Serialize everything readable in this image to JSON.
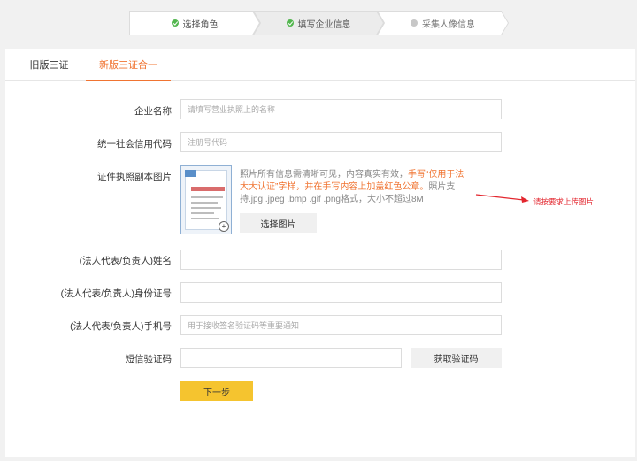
{
  "stepper": {
    "steps": [
      {
        "label": "选择角色",
        "status": "done"
      },
      {
        "label": "填写企业信息",
        "status": "done"
      },
      {
        "label": "采集人像信息",
        "status": "todo"
      }
    ]
  },
  "tabs": [
    {
      "label": "旧版三证",
      "active": false
    },
    {
      "label": "新版三证合一",
      "active": true
    }
  ],
  "form": {
    "company_name": {
      "label": "企业名称",
      "value": "",
      "placeholder": "请填写营业执照上的名称"
    },
    "credit_code": {
      "label": "统一社会信用代码",
      "value": "",
      "placeholder": "注册号代码"
    },
    "license": {
      "label": "证件执照副本图片",
      "desc_prefix": "照片所有信息需清晰可见，内容真实有效，",
      "desc_highlight": "手写“仅用于法大大认证”字样，并在手写内容上加盖红色公章。",
      "desc_suffix": "照片支持.jpg .jpeg .bmp .gif .png格式，大小不超过8M",
      "select_button": "选择图片",
      "zoom_icon": "zoom-in-icon"
    },
    "legal_name": {
      "label": "(法人代表/负责人)姓名",
      "value": "",
      "placeholder": ""
    },
    "legal_id": {
      "label": "(法人代表/负责人)身份证号",
      "value": "",
      "placeholder": ""
    },
    "legal_phone": {
      "label": "(法人代表/负责人)手机号",
      "value": "",
      "placeholder": "用于接收签名验证码等重要通知"
    },
    "sms_code": {
      "label": "短信验证码",
      "value": "",
      "placeholder": "",
      "button": "获取验证码"
    },
    "next_button": "下一步"
  },
  "annotation": {
    "text": "请按要求上传图片"
  },
  "colors": {
    "accent": "#f07432",
    "done": "#52b64e",
    "next_button": "#f5c42f",
    "annotation": "#e3262e"
  }
}
